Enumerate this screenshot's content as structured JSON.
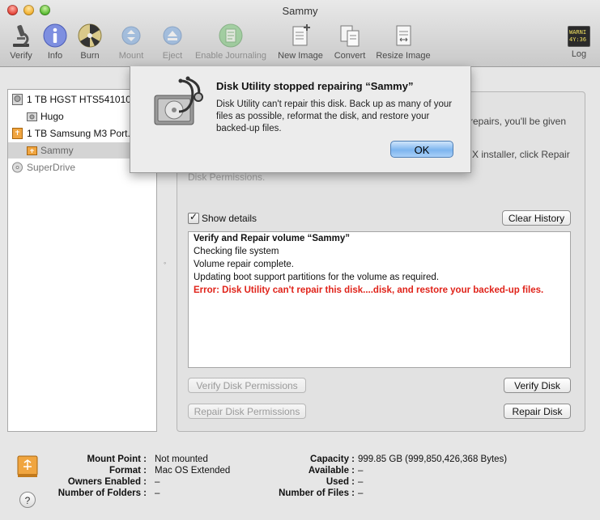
{
  "window": {
    "title": "Sammy"
  },
  "toolbar": {
    "verify": "Verify",
    "info": "Info",
    "burn": "Burn",
    "mount": "Mount",
    "eject": "Eject",
    "enable_journaling": "Enable Journaling",
    "new_image": "New Image",
    "convert": "Convert",
    "resize_image": "Resize Image",
    "log": "Log",
    "log_icon_text": "WARNI\n4Y:36"
  },
  "sidebar": {
    "items": [
      {
        "label": "1 TB HGST HTS541010...",
        "icon": "internal-disk-icon"
      },
      {
        "label": "Hugo",
        "icon": "volume-icon"
      },
      {
        "label": "1 TB Samsung M3 Port...",
        "icon": "external-disk-icon"
      },
      {
        "label": "Sammy",
        "icon": "external-volume-icon"
      },
      {
        "label": "SuperDrive",
        "icon": "optical-drive-icon"
      }
    ]
  },
  "background_text": {
    "line1_right": "repairs, you'll be given",
    "line3_right": "X installer, click Repair",
    "line4": "Disk Permissions."
  },
  "details": {
    "show_details_label": "Show details",
    "clear_history": "Clear History",
    "log_lines": [
      "Verify and Repair volume “Sammy”",
      "Checking file system",
      "Volume repair complete.",
      "Updating boot support partitions for the volume as required.",
      "Error: Disk Utility can't repair this disk....disk, and restore your backed-up files."
    ]
  },
  "buttons": {
    "verify_permissions": "Verify Disk Permissions",
    "verify_disk": "Verify Disk",
    "repair_permissions": "Repair Disk Permissions",
    "repair_disk": "Repair Disk"
  },
  "info": {
    "mount_point_label": "Mount Point :",
    "mount_point_value": "Not mounted",
    "format_label": "Format :",
    "format_value": "Mac OS Extended",
    "owners_label": "Owners Enabled :",
    "owners_value": "–",
    "folders_label": "Number of Folders :",
    "folders_value": "–",
    "capacity_label": "Capacity :",
    "capacity_value": "999.85 GB (999,850,426,368 Bytes)",
    "available_label": "Available :",
    "available_value": "–",
    "used_label": "Used :",
    "used_value": "–",
    "files_label": "Number of Files :",
    "files_value": "–"
  },
  "help": {
    "label": "?"
  },
  "alert": {
    "title": "Disk Utility stopped repairing “Sammy”",
    "message": "Disk Utility can't repair this disk. Back up as many of your files as possible, reformat the disk, and restore your backed-up files.",
    "ok": "OK"
  }
}
